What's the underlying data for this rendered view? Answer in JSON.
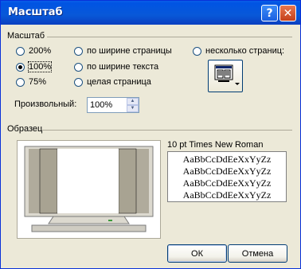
{
  "window": {
    "title": "Масштаб",
    "help_button": "?",
    "close_button": "✕"
  },
  "zoom_group": {
    "label": "Масштаб",
    "options": [
      {
        "label": "200%",
        "checked": false
      },
      {
        "label": "100%",
        "checked": true
      },
      {
        "label": "75%",
        "checked": false
      },
      {
        "label": "по ширине страницы",
        "checked": false
      },
      {
        "label": "по ширине текста",
        "checked": false
      },
      {
        "label": "целая страница",
        "checked": false
      },
      {
        "label": "несколько страниц:",
        "checked": false
      }
    ],
    "pages_button_icon": "multiple-pages-icon",
    "custom_label": "Произвольный:",
    "custom_value": "100%"
  },
  "preview_group": {
    "label": "Образец",
    "font_label": "10 pt Times New Roman",
    "sample_lines": [
      "AaBbCcDdEeXxYyZz",
      "AaBbCcDdEeXxYyZz",
      "AaBbCcDdEeXxYyZz",
      "AaBbCcDdEeXxYyZz"
    ]
  },
  "buttons": {
    "ok": "ОК",
    "cancel": "Отмена"
  },
  "colors": {
    "title_bar": "#0054e3",
    "dialog_bg": "#ece9d8",
    "close_button": "#c4401a"
  }
}
